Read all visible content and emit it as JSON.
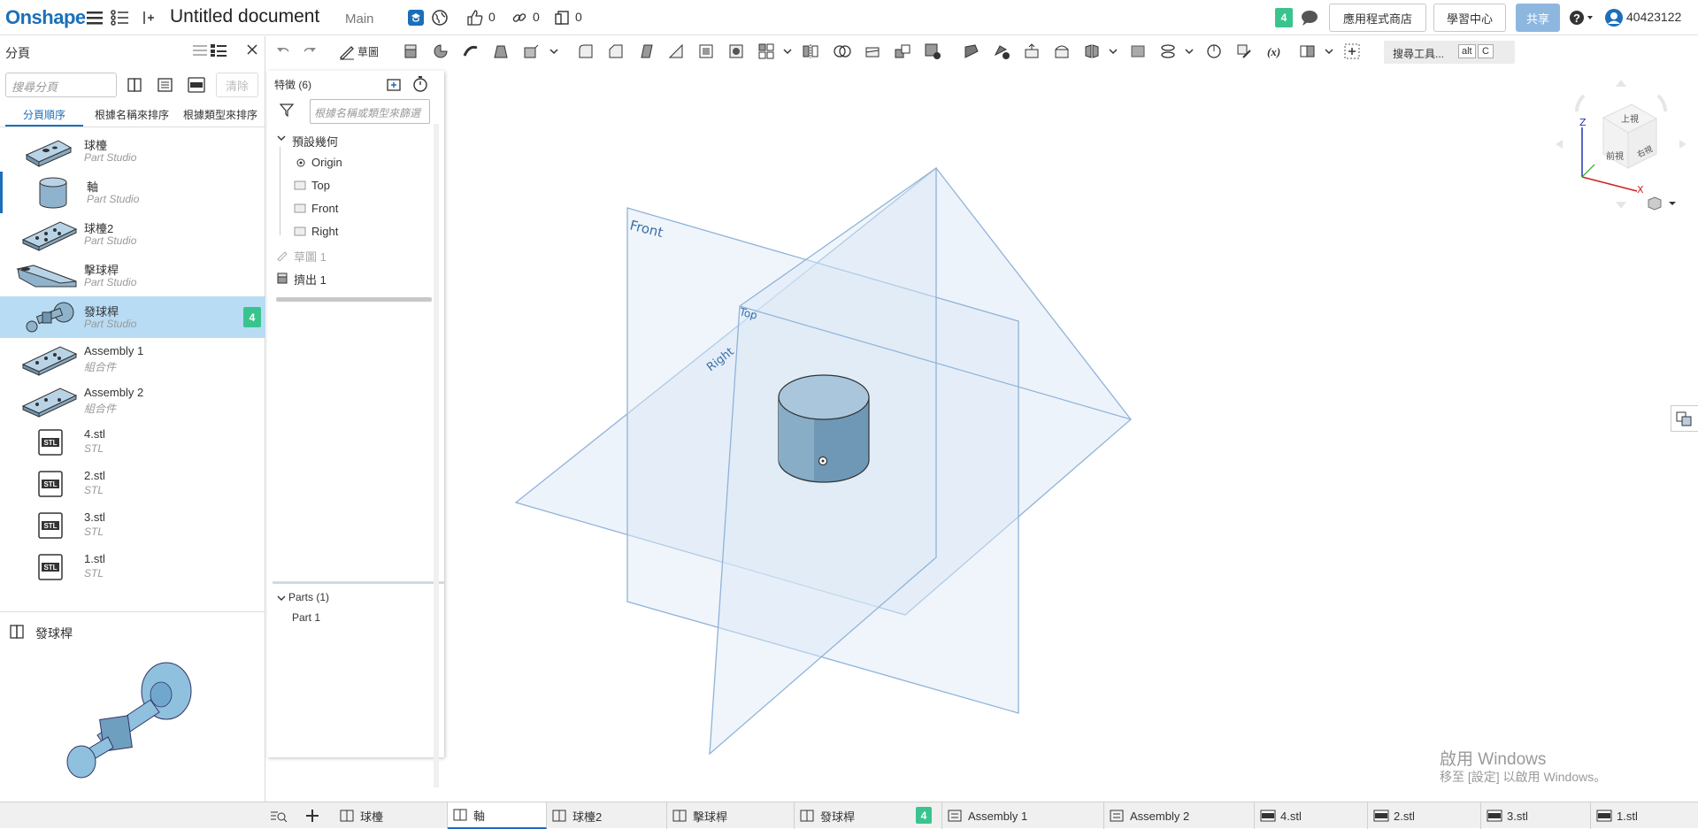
{
  "app": {
    "logo": "Onshape",
    "title": "Untitled document",
    "branch": "Main",
    "likes": "0",
    "links": "0",
    "copies": "0",
    "notification_count": "4",
    "app_store_label": "應用程式商店",
    "learning_center_label": "學習中心",
    "share_label": "共享",
    "user": "40423122"
  },
  "left_panel": {
    "title": "分頁",
    "search_placeholder": "搜尋分頁",
    "clear_label": "清除",
    "sort_tabs": [
      "分頁順序",
      "根據名稱來排序",
      "根據類型來排序"
    ],
    "tabs": [
      {
        "name": "球檯",
        "type": "Part Studio",
        "icon": "plate-thumbnail"
      },
      {
        "name": "軸",
        "type": "Part Studio",
        "icon": "cylinder-thumbnail"
      },
      {
        "name": "球檯2",
        "type": "Part Studio",
        "icon": "plate-thumbnail"
      },
      {
        "name": "擊球桿",
        "type": "Part Studio",
        "icon": "lever-thumbnail"
      },
      {
        "name": "發球桿",
        "type": "Part Studio",
        "icon": "plunger-thumbnail",
        "badge": "4"
      },
      {
        "name": "Assembly 1",
        "type": "組合件",
        "icon": "plate-thumbnail"
      },
      {
        "name": "Assembly 2",
        "type": "組合件",
        "icon": "plate-thumbnail"
      },
      {
        "name": "4.stl",
        "type": "STL",
        "icon": "stl-icon"
      },
      {
        "name": "2.stl",
        "type": "STL",
        "icon": "stl-icon"
      },
      {
        "name": "3.stl",
        "type": "STL",
        "icon": "stl-icon"
      },
      {
        "name": "1.stl",
        "type": "STL",
        "icon": "stl-icon"
      }
    ],
    "preview_title": "發球桿"
  },
  "toolbar": {
    "sketch_label": "草圖",
    "search_tools_label": "搜尋工具...",
    "shortcut_key1": "alt",
    "shortcut_key2": "C"
  },
  "feature_panel": {
    "title": "特徵 (6)",
    "filter_placeholder": "根據名稱或類型來篩選",
    "default_geometry_label": "預設幾何",
    "geometry_items": [
      "Origin",
      "Top",
      "Front",
      "Right"
    ],
    "features": [
      "草圖 1",
      "擠出 1"
    ],
    "parts_header": "Parts (1)",
    "parts": [
      "Part 1"
    ]
  },
  "viewport": {
    "plane_labels": [
      "Front",
      "Top",
      "Right"
    ],
    "view_cube": {
      "top": "上視",
      "front": "前視",
      "right": "右視",
      "z": "Z",
      "x": "X"
    },
    "watermark_title": "啟用 Windows",
    "watermark_sub": "移至 [設定] 以啟用 Windows。"
  },
  "bottom_tabs": [
    {
      "label": "球檯",
      "kind": "partstudio"
    },
    {
      "label": "軸",
      "kind": "partstudio"
    },
    {
      "label": "球檯2",
      "kind": "partstudio"
    },
    {
      "label": "擊球桿",
      "kind": "partstudio"
    },
    {
      "label": "發球桿",
      "kind": "partstudio",
      "badge": "4"
    },
    {
      "label": "Assembly 1",
      "kind": "assembly"
    },
    {
      "label": "Assembly 2",
      "kind": "assembly"
    },
    {
      "label": "4.stl",
      "kind": "stl"
    },
    {
      "label": "2.stl",
      "kind": "stl"
    },
    {
      "label": "3.stl",
      "kind": "stl"
    },
    {
      "label": "1.stl",
      "kind": "stl"
    }
  ],
  "colors": {
    "brand": "#1b6fb9",
    "selected_tab": "#b8dcf4",
    "badge": "#3ac48d",
    "plane_fill": "#dbe8f6",
    "plane_stroke": "#8fb3d9",
    "part_fill": "#7fa8c4"
  }
}
